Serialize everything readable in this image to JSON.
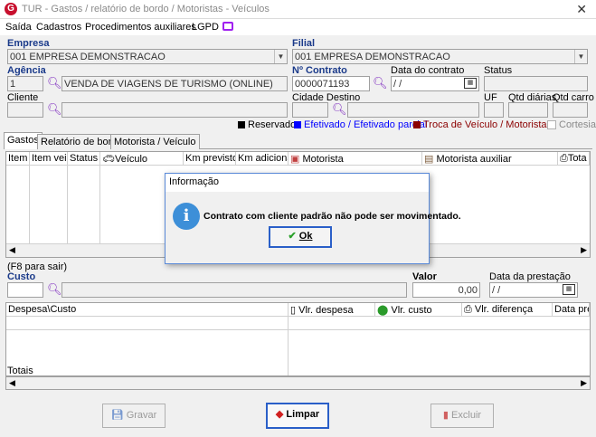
{
  "window": {
    "title": "TUR - Gastos / relatório de bordo / Motoristas - Veículos",
    "logo": "G",
    "close": "✕"
  },
  "menu": [
    "Saída",
    "Cadastros",
    "Procedimentos auxiliares",
    "LGPD"
  ],
  "form": {
    "empresa_label": "Empresa",
    "empresa_value": "001 EMPRESA DEMONSTRACAO",
    "filial_label": "Filial",
    "filial_value": "001 EMPRESA DEMONSTRACAO",
    "agencia_label": "Agência",
    "agencia_code": "1",
    "agencia_name": "VENDA DE VIAGENS DE TURISMO (ONLINE)",
    "contrato_label": "Nº Contrato",
    "contrato_value": "0000071193",
    "data_contrato_label": "Data do contrato",
    "data_contrato_value": "/ /",
    "status_label": "Status",
    "cliente_label": "Cliente",
    "cidade_destino_label": "Cidade Destino",
    "uf_label": "UF",
    "qtd_diarias_label": "Qtd diárias",
    "qtd_carro_label": "Qtd carro"
  },
  "legend": [
    {
      "label": "Reservado",
      "color": "#000000"
    },
    {
      "label": "Efetivado / Efetivado parcial",
      "color": "#0000ff"
    },
    {
      "label": "Troca de Veículo / Motorista",
      "color": "#8b0000"
    }
  ],
  "cortesia_label": "Cortesia",
  "tabs": [
    "Gastos",
    "Relatório de bordo",
    "Motorista / Veículo"
  ],
  "grid1_headers": [
    "Item",
    "Item veic",
    "Status",
    "Veículo",
    "Km previsto",
    "Km adicional",
    "Motorista",
    "Motorista auxiliar",
    "Tota"
  ],
  "f8_hint": "(F8 para sair)",
  "custo_label": "Custo",
  "valor_label": "Valor",
  "valor_value": "0,00",
  "data_prestacao_label": "Data da prestação",
  "data_prestacao_value": "/ /",
  "grid2_headers": [
    "Despesa\\Custo",
    "Vlr. despesa",
    "Vlr. custo",
    "Vlr. diferença",
    "Data prest"
  ],
  "totais_label": "Totais",
  "buttons": {
    "gravar": "Gravar",
    "limpar": "Limpar",
    "excluir": "Excluir"
  },
  "dialog": {
    "title": "Informação",
    "message": "Contrato com cliente padrão não pode ser movimentado.",
    "ok": "Ok"
  }
}
